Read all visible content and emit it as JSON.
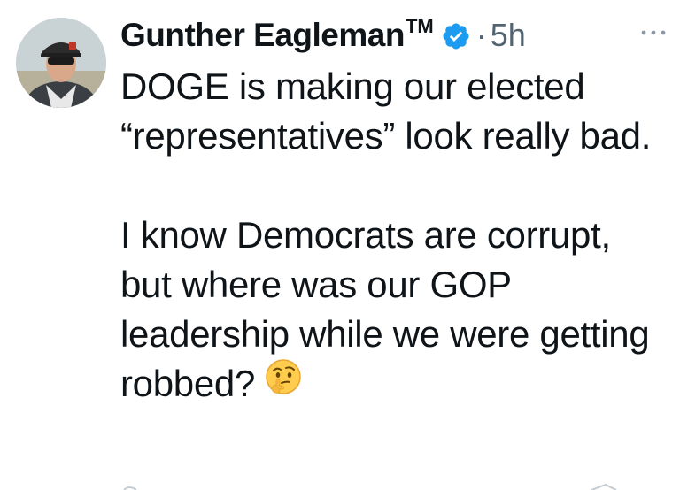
{
  "author": {
    "display_name": "Gunther Eagleman",
    "trademark": "TM",
    "verified": true,
    "avatar_icon": "profile-photo"
  },
  "meta": {
    "separator": "·",
    "time": "5h",
    "more_icon": "more-options-icon"
  },
  "tweet": {
    "paragraph_1": "DOGE is making our elected “representatives” look really bad.",
    "paragraph_2": "I know Democrats are corrupt,  but where was our GOP leadership while we were getting robbed?",
    "emoji": "thinking-face-emoji"
  },
  "colors": {
    "verified_blue": "#1d9bf0",
    "text": "#0f1419",
    "muted": "#536471"
  }
}
